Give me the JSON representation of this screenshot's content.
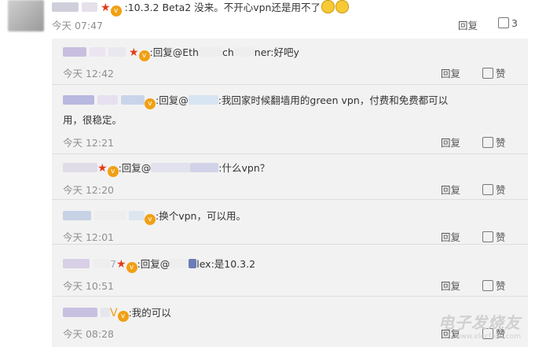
{
  "comment": {
    "text_tail": "10.3.2 Beta2 没来。不开心vpn还是用不了",
    "time": "今天 07:47",
    "reply_label": "回复",
    "like_count": "3"
  },
  "replies": [
    {
      "lead": "回复@Eth",
      "mid": "ch",
      "tail": "ner:好吧y",
      "time": "今天 12:42",
      "reply": "回复",
      "like": "赞"
    },
    {
      "lead": "回复@",
      "tail": "我回家时候翻墙用的green vpn，付费和免费都可以",
      "line2": "用，很稳定。",
      "time": "今天 12:21",
      "reply": "回复",
      "like": "赞"
    },
    {
      "lead": "回复@",
      "tail": ":什么vpn？",
      "time": "今天 12:20",
      "reply": "回复",
      "like": "赞"
    },
    {
      "lead": "换个vpn，可以用。",
      "time": "今天 12:01",
      "reply": "回复",
      "like": "赞"
    },
    {
      "pre": "7",
      "lead": "回复@",
      "tail": "lex:是10.3.2",
      "time": "今天 10:51",
      "reply": "回复",
      "like": "赞"
    },
    {
      "lead": "我的可以",
      "time": "今天 08:28",
      "reply": "回复",
      "like": "赞"
    }
  ],
  "watermark": {
    "main": "电子发烧友",
    "sub": "www.elecfans.com"
  }
}
